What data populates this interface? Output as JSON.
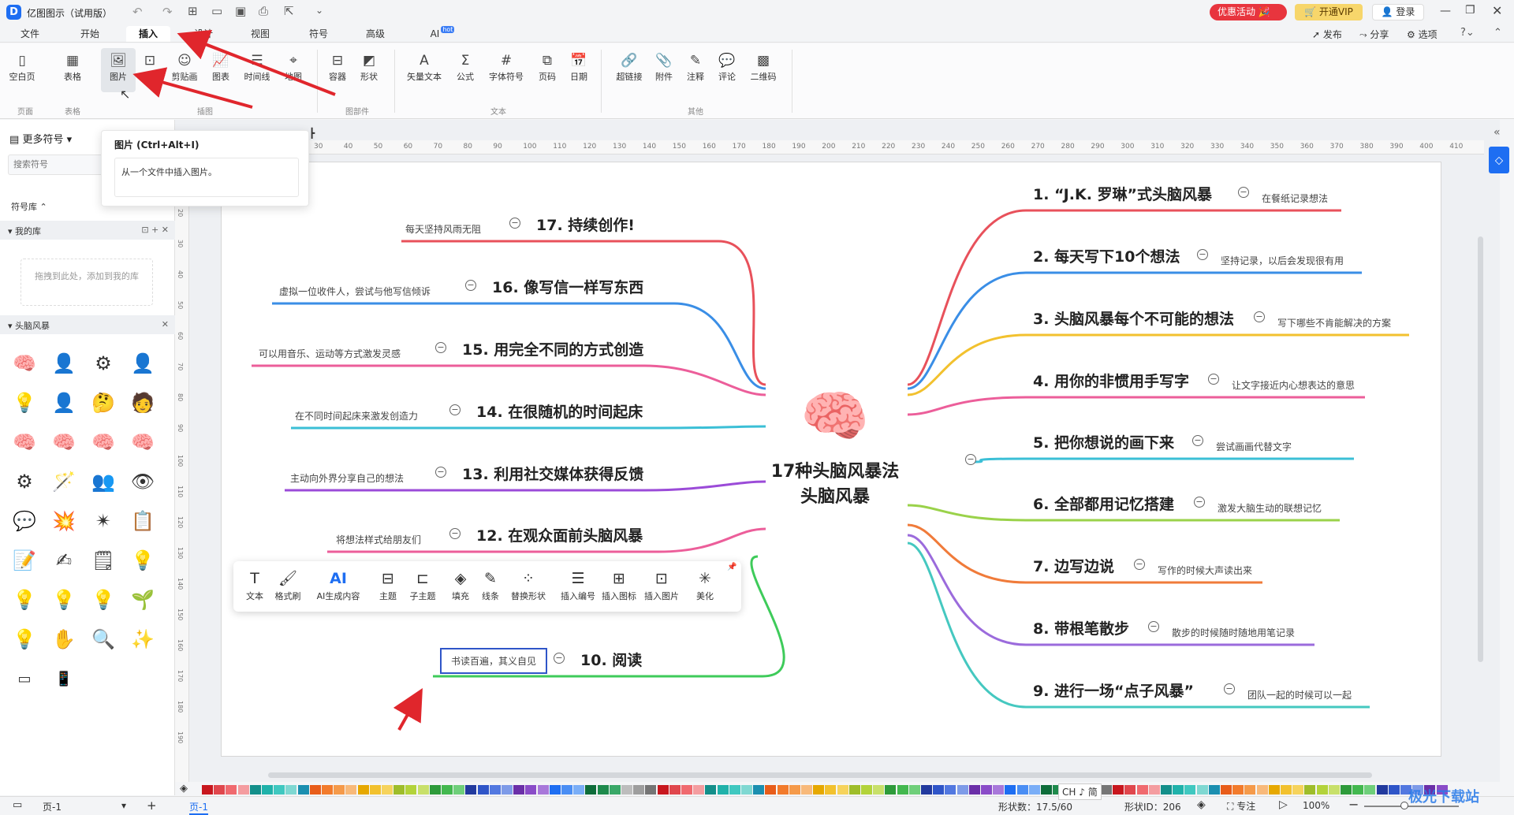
{
  "app": {
    "title": "亿图图示（试用版）"
  },
  "titlebar": {
    "promo": "优惠活动",
    "vip": "开通VIP",
    "login": "登录"
  },
  "menus": [
    "文件",
    "开始",
    "插入",
    "设计",
    "视图",
    "符号",
    "高级",
    "AI"
  ],
  "ai_badge": "hot",
  "right_actions": [
    "发布",
    "分享",
    "选项"
  ],
  "ribbon": {
    "buttons": [
      "空白页",
      "表格",
      "图片",
      "图像",
      "剪贴画",
      "图表",
      "时间线",
      "地图",
      "容器",
      "形状",
      "矢量文本",
      "公式",
      "字体符号",
      "页码",
      "日期",
      "超链接",
      "附件",
      "注释",
      "评论",
      "二维码"
    ],
    "groups": [
      "页面",
      "表格",
      "插图",
      "图部件",
      "文本",
      "其他"
    ]
  },
  "tooltip": {
    "title": "图片 (Ctrl+Alt+I)",
    "desc": "从一个文件中插入图片。"
  },
  "sidebar": {
    "more_symbols": "更多符号",
    "search_placeholder": "搜索符号",
    "library": "符号库",
    "my_library": "我的库",
    "drop_hint": "拖拽到此处，添加到我的库",
    "category": "头脑风暴"
  },
  "mindmap": {
    "center_line1": "17种头脑风暴法",
    "center_line2": "头脑风暴",
    "right": [
      {
        "title": "1. “J.K. 罗琳”式头脑风暴",
        "note": "在餐纸记录想法",
        "color": "#e8515b"
      },
      {
        "title": "2. 每天写下10个想法",
        "note": "坚持记录，以后会发现很有用",
        "color": "#3a8ee6"
      },
      {
        "title": "3. 头脑风暴每个不可能的想法",
        "note": "写下哪些不肯能解决的方案",
        "color": "#f2c12e"
      },
      {
        "title": "4. 用你的非惯用手写字",
        "note": "让文字接近内心想表达的意思",
        "color": "#ec5e9a"
      },
      {
        "title": "5. 把你想说的画下来",
        "note": "尝试画画代替文字",
        "color": "#3bbfd6"
      },
      {
        "title": "6. 全部都用记忆搭建",
        "note": "激发大脑生动的联想记忆",
        "color": "#9ad24a"
      },
      {
        "title": "7. 边写边说",
        "note": "写作的时候大声读出来",
        "color": "#f07b3a"
      },
      {
        "title": "8. 带根笔散步",
        "note": "散步的时候随时随地用笔记录",
        "color": "#9b6bdc"
      },
      {
        "title": "9. 进行一场“点子风暴”",
        "note": "团队一起的时候可以一起",
        "color": "#45c8c0"
      }
    ],
    "left": [
      {
        "title": "17. 持续创作!",
        "note": "每天坚持风雨无阻",
        "color": "#e8515b"
      },
      {
        "title": "16. 像写信一样写东西",
        "note": "虚拟一位收件人，尝试与他写信倾诉",
        "color": "#3a8ee6"
      },
      {
        "title": "15. 用完全不同的方式创造",
        "note": "可以用音乐、运动等方式激发灵感",
        "color": "#ec5e9a"
      },
      {
        "title": "14. 在很随机的时间起床",
        "note": "在不同时间起床来激发创造力",
        "color": "#3bbfd6"
      },
      {
        "title": "13. 利用社交媒体获得反馈",
        "note": "主动向外界分享自己的想法",
        "color": "#9b4bd8"
      },
      {
        "title": "12. 在观众面前头脑风暴",
        "note": "将想法样式给朋友们",
        "color": "#ec5e9a"
      },
      {
        "title": "10. 阅读",
        "note": "书读百遍，其义自见",
        "color": "#3ecb5a"
      }
    ]
  },
  "floatbar": [
    "文本",
    "格式刷",
    "AI生成内容",
    "主题",
    "子主题",
    "填充",
    "线条",
    "替换形状",
    "插入编号",
    "插入图标",
    "插入图片",
    "美化"
  ],
  "ruler_labels": [
    "30",
    "40",
    "50",
    "60",
    "70",
    "80",
    "90",
    "100",
    "110",
    "120",
    "130",
    "140",
    "150",
    "160",
    "170",
    "180",
    "190",
    "200",
    "210",
    "220",
    "230",
    "240",
    "250",
    "260",
    "270",
    "280",
    "290",
    "300",
    "310",
    "320",
    "330",
    "340",
    "350",
    "360",
    "370",
    "380",
    "390",
    "400",
    "410"
  ],
  "ruler_left_labels": [
    "10",
    "20",
    "30",
    "40",
    "50",
    "60",
    "70",
    "80",
    "90",
    "100",
    "110",
    "120",
    "130",
    "140",
    "150",
    "160",
    "170",
    "180",
    "190"
  ],
  "status": {
    "page_tab": "页-1",
    "page_tab2": "页-1",
    "shape_count": "形状数：17.5/60",
    "shape_id": "形状ID：206",
    "focus": "专注",
    "zoom": "100%",
    "ime": "CH ♪ 简"
  },
  "watermark": "极光下载站"
}
